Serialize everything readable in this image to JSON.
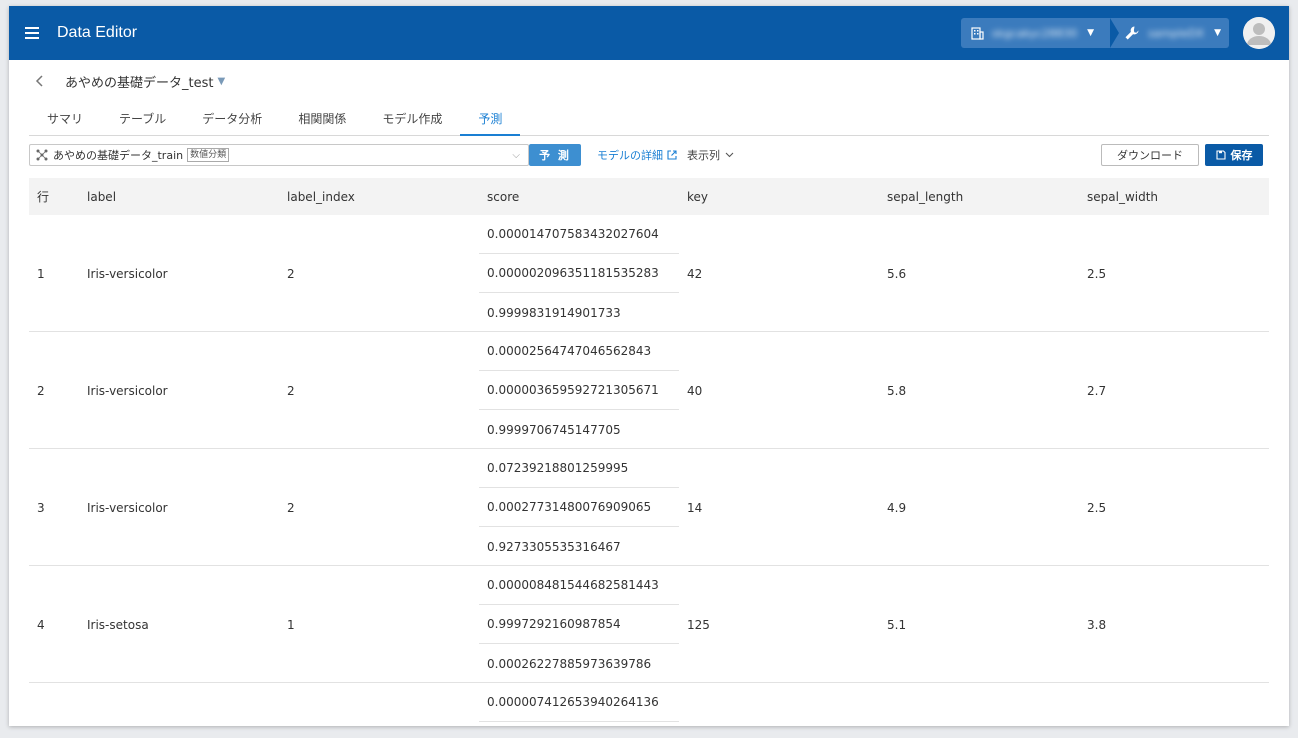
{
  "app": {
    "title": "Data Editor",
    "org_label": "skgcakyc28830",
    "project_label": "sampleDX"
  },
  "dataset": {
    "title": "あやめの基礎データ_test"
  },
  "tabs": [
    {
      "label": "サマリ"
    },
    {
      "label": "テーブル"
    },
    {
      "label": "データ分析"
    },
    {
      "label": "相関関係"
    },
    {
      "label": "モデル作成"
    },
    {
      "label": "予測",
      "active": true
    }
  ],
  "toolbar": {
    "model_name": "あやめの基礎データ_train",
    "model_type_tag": "数値分類",
    "predict_label": "予 測",
    "model_detail_label": "モデルの詳細",
    "columns_label": "表示列",
    "download_label": "ダウンロード",
    "save_label": "保存"
  },
  "table": {
    "headers": [
      "行",
      "label",
      "label_index",
      "score",
      "key",
      "sepal_length",
      "sepal_width"
    ],
    "rows": [
      {
        "row": "1",
        "label": "Iris-versicolor",
        "label_index": "2",
        "scores": [
          "0.000014707583432027604",
          "0.000002096351181535283",
          "0.9999831914901733"
        ],
        "key": "42",
        "sepal_length": "5.6",
        "sepal_width": "2.5"
      },
      {
        "row": "2",
        "label": "Iris-versicolor",
        "label_index": "2",
        "scores": [
          "0.00002564747046562843",
          "0.000003659592721305671",
          "0.9999706745147705"
        ],
        "key": "40",
        "sepal_length": "5.8",
        "sepal_width": "2.7"
      },
      {
        "row": "3",
        "label": "Iris-versicolor",
        "label_index": "2",
        "scores": [
          "0.07239218801259995",
          "0.00027731480076909065",
          "0.9273305535316467"
        ],
        "key": "14",
        "sepal_length": "4.9",
        "sepal_width": "2.5"
      },
      {
        "row": "4",
        "label": "Iris-setosa",
        "label_index": "1",
        "scores": [
          "0.000008481544682581443",
          "0.9997292160987854",
          "0.00026227885973639786"
        ],
        "key": "125",
        "sepal_length": "5.1",
        "sepal_width": "3.8"
      }
    ],
    "partial_score": "0.0000074126539402641​36"
  },
  "colors": {
    "appbar": "#0a5aa6",
    "accent": "#1a7fd3",
    "predict_button": "#3d8fd1"
  }
}
